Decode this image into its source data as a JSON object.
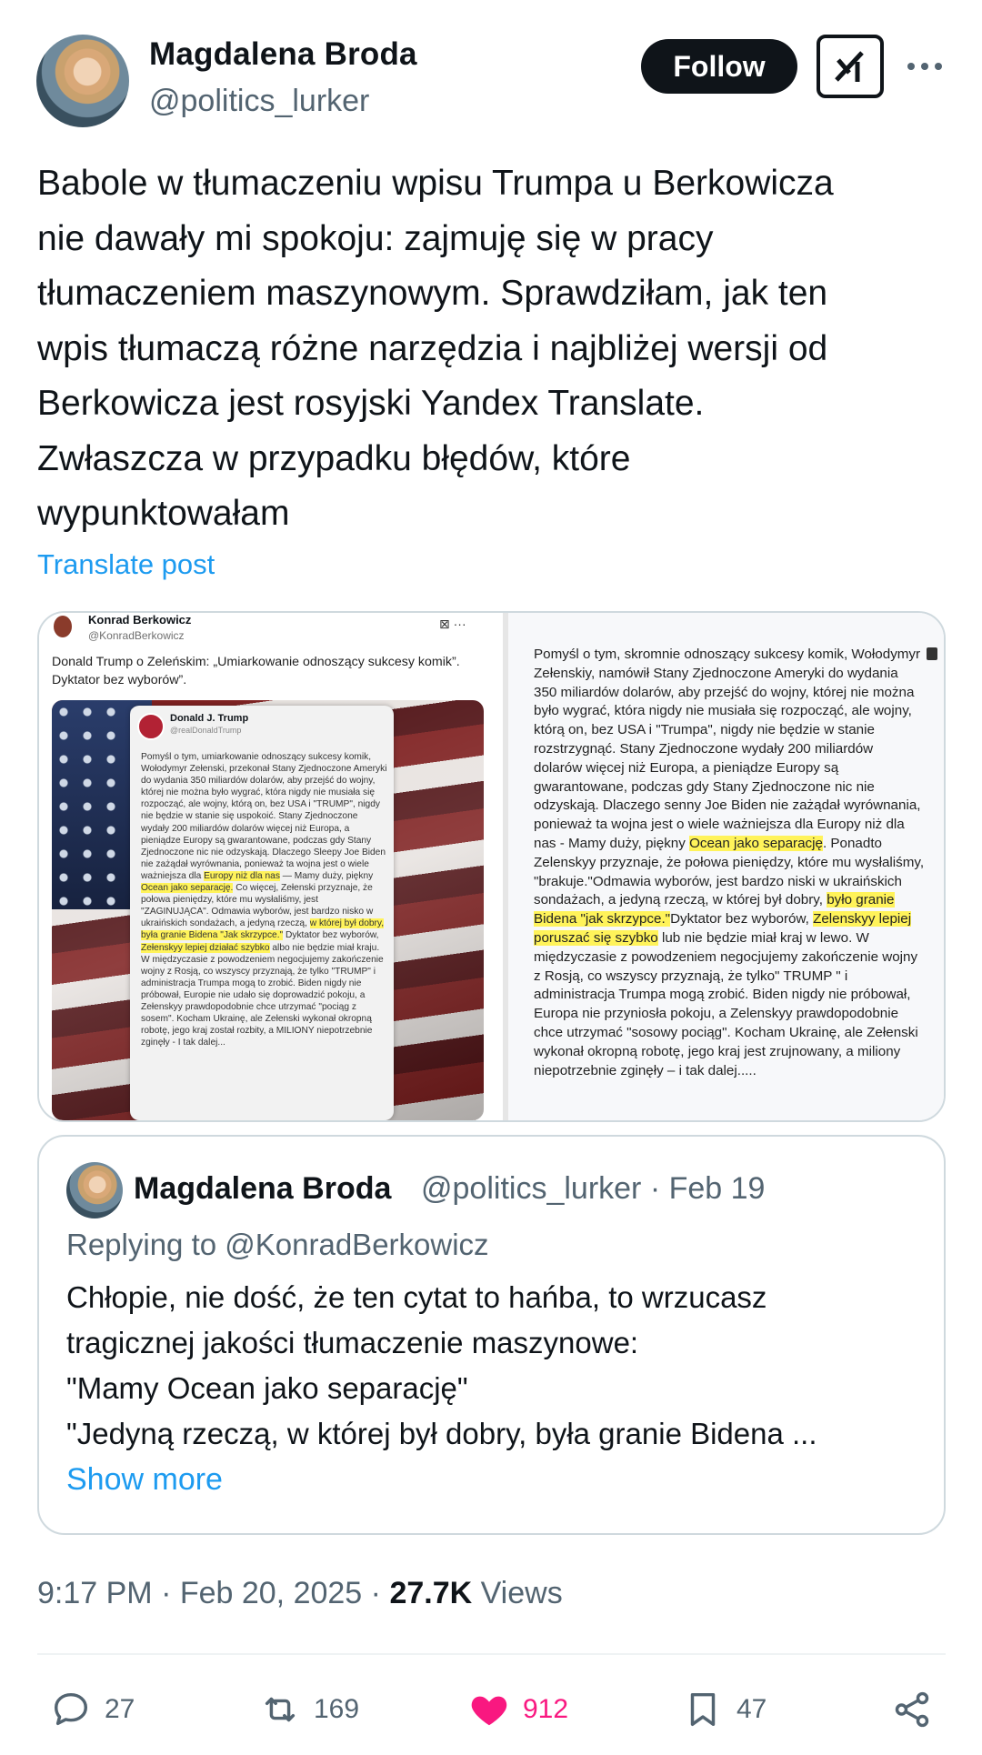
{
  "author": {
    "name": "Magdalena Broda",
    "handle": "@politics_lurker",
    "follow_label": "Follow"
  },
  "post": {
    "text": "Babole w tłumaczeniu wpisu Trumpa u Berkowicza\nnie dawały mi spokoju: zajmuję się w pracy\ntłumaczeniem maszynowym. Sprawdziłam, jak ten\nwpis tłumaczą różne narzędzia i najbliżej wersji od\nBerkowicza jest rosyjski Yandex Translate.\nZwłaszcza w przypadku błędów, które\nwypunktowałam",
    "translate_label": "Translate post"
  },
  "media": {
    "left": {
      "name": "Konrad Berkowicz",
      "handle": "@KonradBerkowicz",
      "text": "Donald Trump o Zeleńskim: „Umiarkowanie odnoszący sukcesy komik”. Dyktator bez wyborów”.",
      "inner": {
        "name": "Donald J. Trump",
        "handle": "@realDonaldTrump",
        "text_before": "Pomyśl o tym, umiarkowanie odnoszący sukcesy komik, Wołodymyr Zełenski, przekonał Stany Zjednoczone Ameryki do wydania 350 miliardów dolarów, aby przejść do wojny, której nie można było wygrać, która nigdy nie musiała się rozpocząć, ale wojny, którą on, bez USA i \"TRUMP\", nigdy nie będzie w stanie się uspokoić. Stany Zjednoczone wydały 200 miliardów dolarów więcej niż Europa, a pieniądze Europy są gwarantowane, podczas gdy Stany Zjednoczone nic nie odzyskają. Dlaczego Sleepy Joe Biden nie zażądał wyrównania, ponieważ ta wojna jest o wiele ważniejsza dla ",
        "hl1": "Europy niż dla nas",
        "text_mid1": " — Mamy duży, piękny ",
        "hl2": "Ocean jako separację.",
        "text_mid2": " Co więcej, Zełenski przyznaje, że połowa pieniędzy, które mu wysłaliśmy, jest \"ZAGINUJĄCA\". Odmawia wyborów, jest bardzo nisko w ukraińskich sondażach, a jedyną rzeczą, ",
        "hl3": "w której był dobry, była granie Bidena \"Jak skrzypce.\"",
        "text_mid3": " Dyktator bez wyborów, ",
        "hl4": "Zełenskyy lepiej działać szybko",
        "text_after": " albo nie będzie miał kraju. W międzyczasie z powodzeniem negocjujemy zakończenie wojny z Rosją, co wszyscy przyznają, że tylko \"TRUMP\" i administracja Trumpa mogą to zrobić. Biden nigdy nie próbował, Europie nie udało się doprowadzić pokoju, a Zełenskyy prawdopodobnie chce utrzymać \"pociąg z sosem\". Kocham Ukrainę, ale Zełenski wykonał okropną robotę, jego kraj został rozbity, a MILIONY niepotrzebnie zginęły - I tak dalej..."
      }
    },
    "right": {
      "text_before": "Pomyśl o tym, skromnie odnoszący sukcesy komik, Wołodymyr Zełenskiy, namówił Stany Zjednoczone Ameryki do wydania 350 miliardów dolarów, aby przejść do wojny, której nie można było wygrać, która nigdy nie musiała się rozpocząć, ale wojny, którą on, bez USA i \"Trumpa\", nigdy nie będzie w stanie rozstrzygnąć. Stany Zjednoczone wydały 200 miliardów dolarów więcej niż Europa, a pieniądze Europy są gwarantowane, podczas gdy Stany Zjednoczone nic nie odzyskają. Dlaczego senny Joe Biden nie zażądał wyrównania, ponieważ ta wojna jest o wiele ważniejsza dla Europy niż dla nas - Mamy duży, piękny ",
      "hl1": "Ocean jako separację",
      "text_mid1": ". Ponadto Zelenskyy przyznaje, że połowa pieniędzy, które mu wysłaliśmy, \"brakuje.\"Odmawia wyborów, jest bardzo niski w ukraińskich sondażach, a jedyną rzeczą, w której był dobry, ",
      "hl2": "było granie Bidena \"jak skrzypce.\"",
      "text_mid2": "Dyktator bez wyborów, ",
      "hl3": "Zelenskyy lepiej poruszać się szybko",
      "text_after": " lub nie będzie miał kraj w lewo. W międzyczasie z powodzeniem negocjujemy zakończenie wojny z Rosją, co wszyscy przyznają, że tylko\" TRUMP \" i administracja Trumpa mogą zrobić. Biden nigdy nie próbował, Europa nie przyniosła pokoju, a Zelenskyy prawdopodobnie chce utrzymać \"sosowy pociąg\". Kocham Ukrainę, ale Zełenski wykonał okropną robotę, jego kraj jest zrujnowany, a miliony niepotrzebnie zginęły – i tak dalej....."
    }
  },
  "quote": {
    "name": "Magdalena Broda",
    "meta": "@politics_lurker · Feb 19",
    "replying": "Replying to @KonradBerkowicz",
    "text": "Chłopie, nie dość, że ten cytat to hańba, to wrzucasz\ntragicznej jakości tłumaczenie maszynowe:\n\"Mamy Ocean jako separację\"\n\"Jedyną rzeczą, w której był dobry, była granie Bidena ...",
    "show_more": "Show more"
  },
  "meta": {
    "time": "9:17 PM · Feb 20, 2025 · ",
    "views_count": "27.7K",
    "views_label": " Views"
  },
  "actions": {
    "replies": "27",
    "reposts": "169",
    "likes": "912",
    "bookmarks": "47"
  },
  "colors": {
    "accent": "#1d9bf0",
    "like": "#f91880",
    "highlight": "#fff35a"
  }
}
